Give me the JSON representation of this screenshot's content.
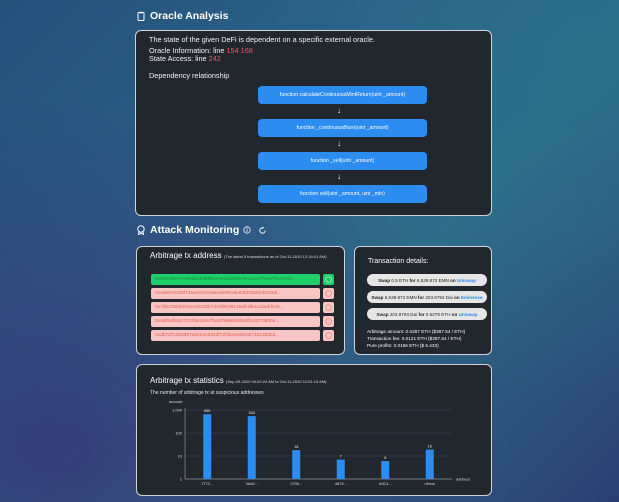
{
  "oracle": {
    "title": "Oracle Analysis",
    "intro": "The state of the given DeFi is dependent on a specific external oracle.",
    "info_label": "Oracle Information: line",
    "info_lines": "154 168",
    "access_label": "State Access: line",
    "access_line": "242",
    "dep_title": "Dependency relationship",
    "flow": [
      "function calculateContinuousMintReturn(uint _amount)",
      "function _continuousBurn(uint _amount)",
      "function _sell(uint _amount)",
      "function sell(uint _amount, uint _min)"
    ],
    "arrow": "↓"
  },
  "attack": {
    "title": "Attack Monitoring",
    "tx_title": "Arbitrage tx address",
    "tx_note": "(The latest 5 transactions as of Oct-11-2020 12:18:41 AM)",
    "addresses": [
      "0x00a3d6e7ce56d3c94f8ff6a79ad3e0bb79c11c1f7fae37fca7cd3...",
      "0x4a59c9168f745ac6c6c0a6eeb99cab403d33af6eb193af...",
      "0x7db27584431ee10243b7410f9039135afcdfe1a1befdec6...",
      "0x4af0ef0dcc701f26c2ee7f1e5758965d484fb1927050b9...",
      "0xdb7d7c0b8987a92e2c834df72f4be6abfe56715c3b6bd..."
    ],
    "details_title": "Transaction details:",
    "swaps": [
      {
        "word": "Swap",
        "amt1": "0.5",
        "tok1": "ETH",
        "for": "for",
        "amt2": "6,539.972",
        "tok2": "EMN",
        "on": "on",
        "dex": "Uniswap"
      },
      {
        "word": "Swap",
        "amt1": "6,539.972",
        "tok1": "EMN",
        "for": "for",
        "amt2": "203.8793",
        "tok2": "Dai",
        "on": "on",
        "dex": "Eminence"
      },
      {
        "word": "Swap",
        "amt1": "203.8793",
        "tok1": "Dai",
        "for": "for",
        "amt2": "0.5278",
        "tok2": "ETH",
        "on": "on",
        "dex": "Uniswap"
      }
    ],
    "stats": [
      "Arbitrage amount: 0.0287 ETH ($387.54 / ETH)",
      "Transaction fee: 0.0121 ETH ($387.54 / ETH)",
      "Pure profits: 0.0166 ETH ($ 6.433)"
    ]
  },
  "chart_data": {
    "type": "bar",
    "title": "Arbitrage tx statistics",
    "title_note": "(Sep-29-2020 00:00:24 AM to Oct-11-2020 12:51:13 AM)",
    "subtitle": "The number of arbitrage tx at suspicious addresses",
    "ylabel": "amount",
    "xlabel": "address",
    "y_ticks": [
      "1,000",
      "100",
      "10",
      "1"
    ],
    "y_scale": "log",
    "ylim": [
      1,
      1000
    ],
    "categories": [
      "7772...",
      "0bA5...",
      "0796...",
      "4B76...",
      "A0C4...",
      "others"
    ],
    "values": [
      655,
      543,
      18,
      7,
      6,
      19
    ],
    "value_labels": [
      "655",
      "543",
      "18",
      "7",
      "6",
      "19"
    ],
    "bar_color": "#2d8cf0",
    "grid": true
  },
  "colors": {
    "accent": "#2d8cf0",
    "selected": "#1fcf6c",
    "danger": "#ff4e6a"
  }
}
